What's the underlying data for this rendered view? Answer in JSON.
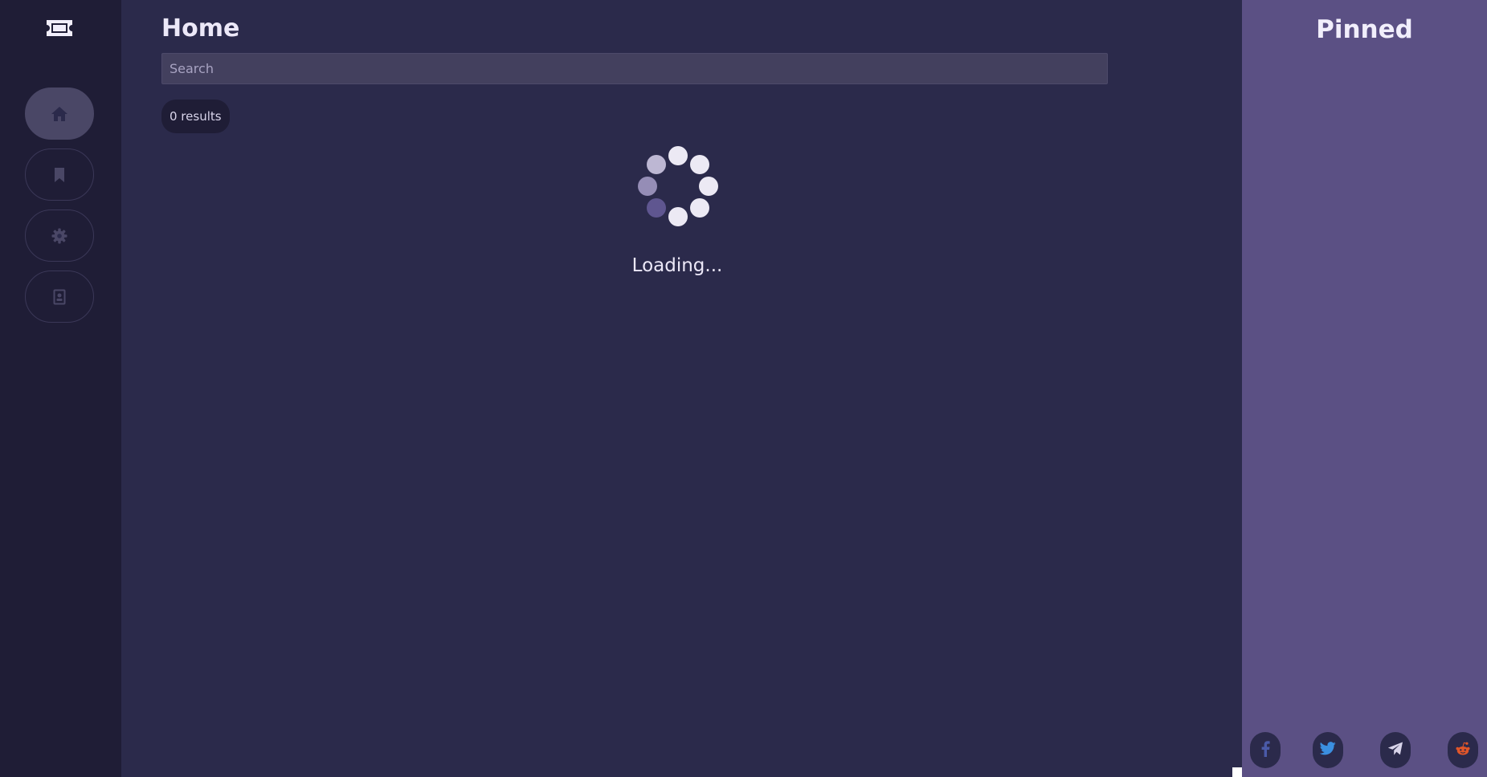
{
  "sidebar": {
    "logo_icon": "ticket-icon",
    "items": [
      {
        "icon": "home-icon",
        "active": true
      },
      {
        "icon": "bookmark-icon",
        "active": false
      },
      {
        "icon": "gear-icon",
        "active": false
      },
      {
        "icon": "contact-card-icon",
        "active": false
      }
    ]
  },
  "main": {
    "title": "Home",
    "search": {
      "placeholder": "Search",
      "value": ""
    },
    "results_label": "0 results",
    "loading_label": "Loading..."
  },
  "pinned": {
    "title": "Pinned",
    "share": [
      {
        "icon": "facebook-icon",
        "color": "#4a5aa8"
      },
      {
        "icon": "twitter-icon",
        "color": "#3b8fe0"
      },
      {
        "icon": "telegram-icon",
        "color": "#d8d4ea"
      },
      {
        "icon": "reddit-icon",
        "color": "#e0562a"
      }
    ]
  },
  "colors": {
    "sidebar_bg": "#1f1d36",
    "main_bg": "#2b2a4b",
    "pinned_bg": "#5b5084",
    "text": "#ece8f8"
  }
}
